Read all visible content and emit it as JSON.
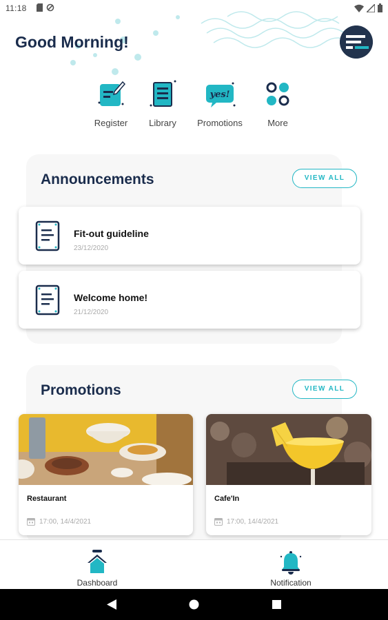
{
  "status_bar": {
    "time": "11:18"
  },
  "header": {
    "greeting": "Good Morning!"
  },
  "quick_actions": [
    {
      "label": "Register",
      "icon": "register-icon"
    },
    {
      "label": "Library",
      "icon": "library-icon"
    },
    {
      "label": "Promotions",
      "icon": "promotions-icon",
      "badge_text": "yes!"
    },
    {
      "label": "More",
      "icon": "more-icon"
    }
  ],
  "announcements": {
    "title": "Announcements",
    "view_all": "VIEW ALL",
    "items": [
      {
        "title": "Fit-out guideline",
        "date": "23/12/2020"
      },
      {
        "title": "Welcome home!",
        "date": "21/12/2020"
      }
    ]
  },
  "promotions": {
    "title": "Promotions",
    "view_all": "VIEW ALL",
    "items": [
      {
        "name": "Restaurant",
        "time": "17:00, 14/4/2021"
      },
      {
        "name": "Cafe'In",
        "time": "17:00, 14/4/2021"
      }
    ]
  },
  "bottom_nav": {
    "dashboard": "Dashboard",
    "notification": "Notification"
  },
  "colors": {
    "accent": "#22b7c4",
    "navy": "#1a2c4c"
  }
}
